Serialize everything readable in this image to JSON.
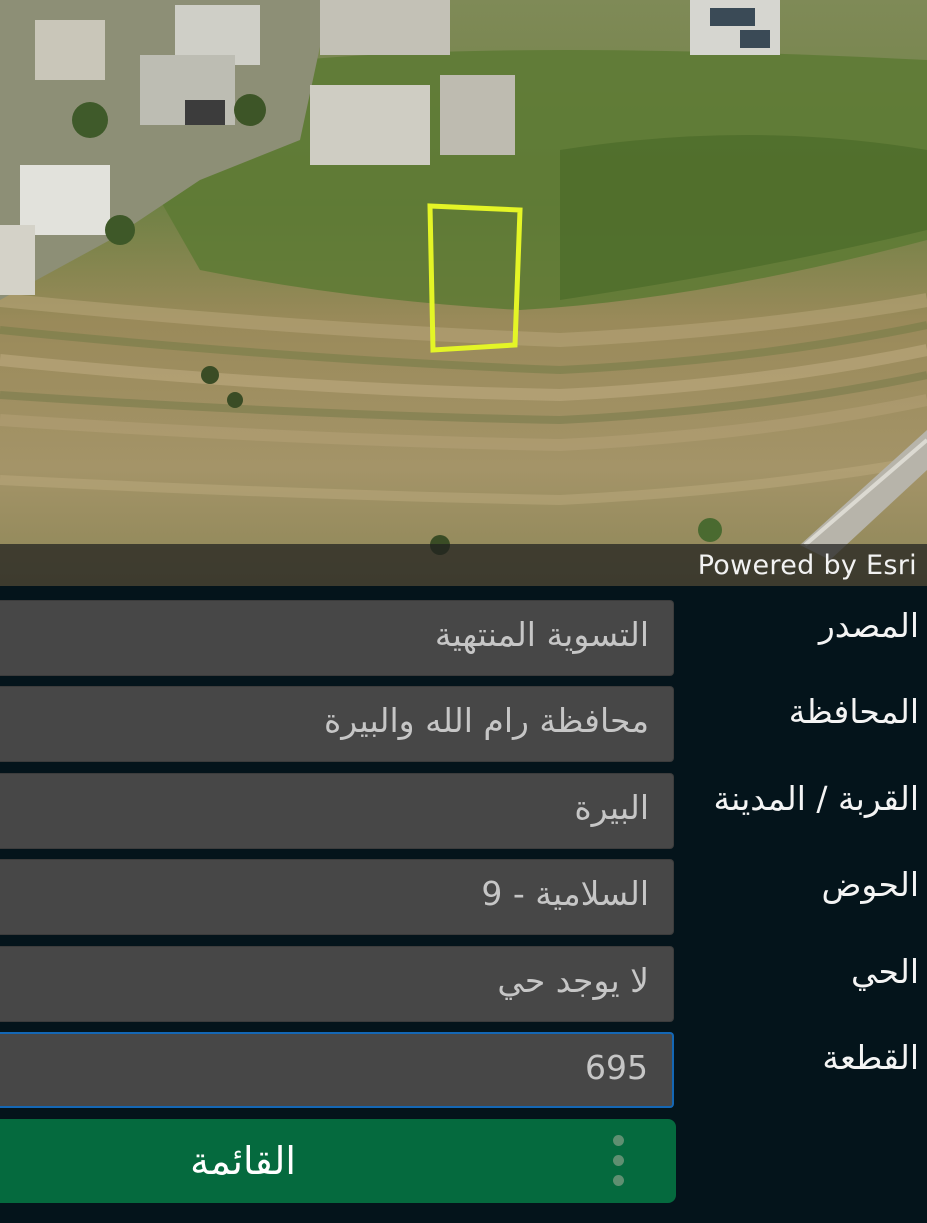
{
  "map": {
    "attribution": "Powered by Esri",
    "parcel_outline_color": "#e4f526"
  },
  "fields": [
    {
      "label": "المصدر",
      "value": "التسوية المنتهية"
    },
    {
      "label": "المحافظة",
      "value": "محافظة رام الله والبيرة"
    },
    {
      "label": "القربة / المدينة",
      "value": "البيرة"
    },
    {
      "label": "الحوض",
      "value": "السلامية - 9"
    },
    {
      "label": "الحي",
      "value": "لا يوجد حي"
    },
    {
      "label": "القطعة",
      "value": "695"
    }
  ],
  "list_button": {
    "label": "القائمة",
    "icon": "vertical-dots-icon"
  },
  "colors": {
    "panel_background": "#04141b",
    "field_background": "#474747",
    "active_border": "#1467b5",
    "button_green": "#056a3e"
  }
}
